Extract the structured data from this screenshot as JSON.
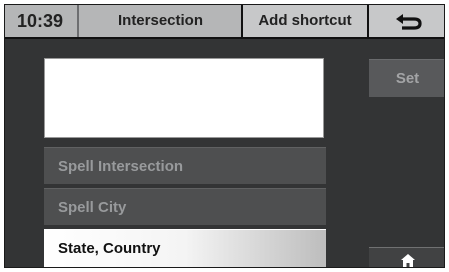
{
  "status": {
    "time": "10:39"
  },
  "header": {
    "title": "Intersection",
    "add_shortcut_label": "Add shortcut",
    "back_icon": "back-arrow-icon"
  },
  "name_display": {
    "value": ""
  },
  "menu": [
    {
      "label": "Spell Intersection",
      "state": "inactive"
    },
    {
      "label": "Spell City",
      "state": "inactive"
    },
    {
      "label": "State, Country",
      "state": "active"
    }
  ],
  "side": {
    "set_label": "Set",
    "home_icon": "home-icon"
  },
  "colors": {
    "screen_bg": "#333435",
    "topbar_bg": "#b5b6b7",
    "inactive_button": "#4e4f50",
    "active_button": "#ffffff"
  }
}
